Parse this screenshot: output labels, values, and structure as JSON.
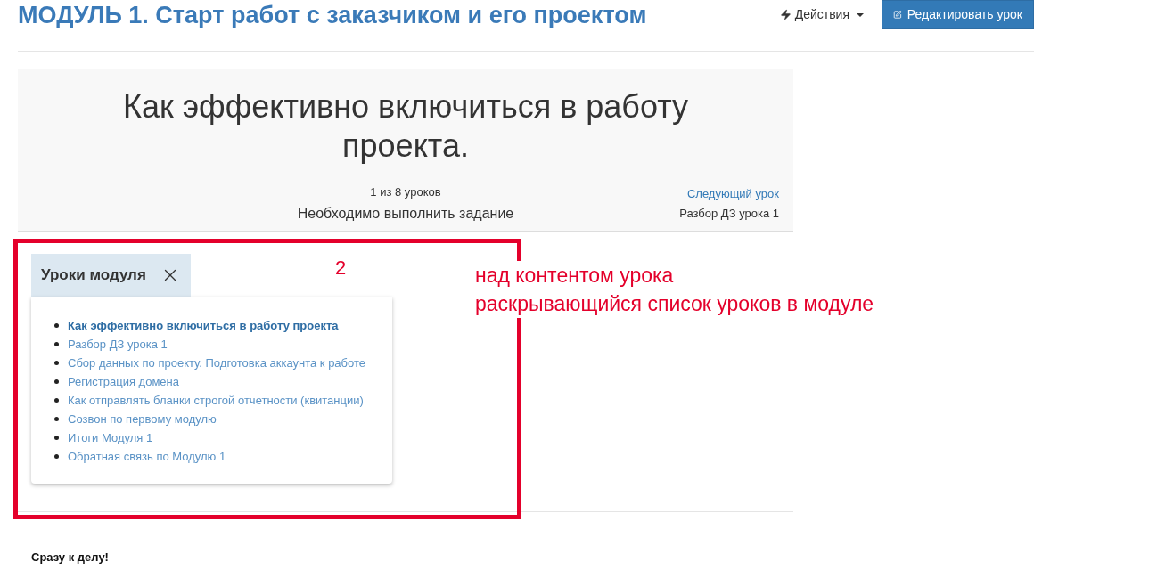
{
  "module_title": "МОДУЛЬ 1. Старт работ с заказчиком и его проектом",
  "actions_menu": {
    "label": "Действия",
    "expanded": false
  },
  "edit_button": {
    "label": "Редактировать урок"
  },
  "lesson": {
    "title": "Как эффективно включиться в работу проекта.",
    "progress": "1 из 8 уроков",
    "requirement": "Необходимо выполнить задание",
    "next_label": "Следующий урок",
    "next_title": "Разбор ДЗ урока 1"
  },
  "module_lessons": {
    "label": "Уроки модуля",
    "expanded": true,
    "items": [
      {
        "title": "Как эффективно включиться в работу проекта",
        "selected": true
      },
      {
        "title": "Разбор ДЗ урока 1",
        "selected": false
      },
      {
        "title": "Сбор данных по проекту. Подготовка аккаунта к работе",
        "selected": false
      },
      {
        "title": "Регистрация домена",
        "selected": false
      },
      {
        "title": "Как отправлять бланки строгой отчетности (квитанции)",
        "selected": false
      },
      {
        "title": "Созвон по первому модулю",
        "selected": false
      },
      {
        "title": "Итоги Модуля 1",
        "selected": false
      },
      {
        "title": "Обратная связь по Модулю 1",
        "selected": false
      }
    ]
  },
  "annotation": {
    "number": "2",
    "lines": [
      "над контентом урока",
      "раскрывающийся список уроков в модуле"
    ]
  },
  "content": {
    "heading": "Сразу к делу!"
  }
}
